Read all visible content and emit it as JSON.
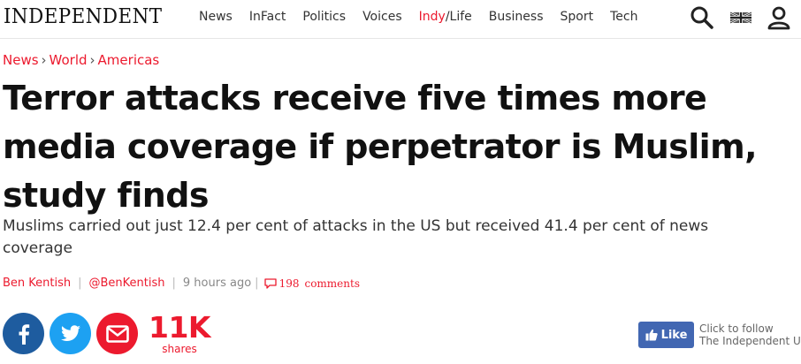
{
  "header": {
    "logo": "INDEPENDENT",
    "nav": [
      {
        "label": "News"
      },
      {
        "label": "InFact"
      },
      {
        "label": "Politics"
      },
      {
        "label": "Voices"
      },
      {
        "label_a": "Indy",
        "label_slash": "/",
        "label_b": "Life"
      },
      {
        "label": "Business"
      },
      {
        "label": "Sport"
      },
      {
        "label": "Tech"
      }
    ],
    "icons": [
      "search-icon",
      "uk-flag-icon",
      "user-icon"
    ]
  },
  "breadcrumb": {
    "items": [
      "News",
      "World",
      "Americas"
    ],
    "separator": "›"
  },
  "article": {
    "headline": "Terror attacks receive five times more media coverage if perpetrator is Muslim, study finds",
    "standfirst": "Muslims carried out just 12.4 per cent of attacks in the US but received 41.4 per cent of news coverage",
    "author": "Ben Kentish",
    "handle": "@BenKentish",
    "time": "9 hours ago",
    "comments_count": "198",
    "comments_label": "comments"
  },
  "share": {
    "count": "11K",
    "label": "shares",
    "buttons": [
      "facebook-icon",
      "twitter-icon",
      "email-icon"
    ]
  },
  "follow": {
    "button_label": "Like",
    "line1": "Click to follow",
    "line2": "The Independent US"
  },
  "colors": {
    "accent": "#ec1a2e",
    "facebook": "#1e5c9f",
    "twitter": "#1da1f2",
    "fb_like": "#4267b2"
  }
}
